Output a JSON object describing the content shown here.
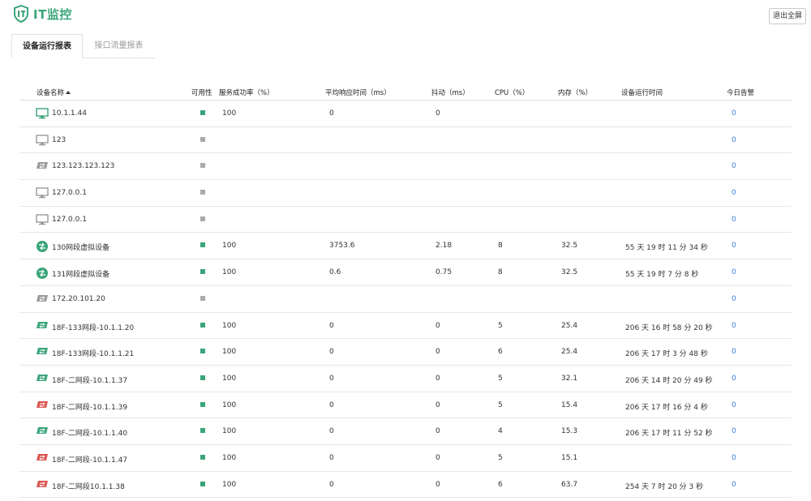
{
  "app": {
    "logo_text": "IT监控",
    "exit_fullscreen": "退出全屏"
  },
  "tabs": [
    {
      "label": "设备运行报表",
      "active": true
    },
    {
      "label": "接口流量报表",
      "active": false
    }
  ],
  "colors": {
    "brand": "#3aa57a",
    "available": "#3aa57a",
    "unavailable": "#aaaaaa",
    "device_green": "#3aa57a",
    "device_gray": "#999999",
    "device_red": "#d9534f",
    "link": "#3b7dd8"
  },
  "table": {
    "columns": [
      {
        "key": "name",
        "label": "设备名称",
        "sorted": "asc"
      },
      {
        "key": "availability",
        "label": "可用性"
      },
      {
        "key": "success_rate",
        "label": "服务成功率（%）"
      },
      {
        "key": "response_time",
        "label": "平均响应时间（ms）"
      },
      {
        "key": "jitter",
        "label": "抖动（ms）"
      },
      {
        "key": "cpu",
        "label": "CPU（%）"
      },
      {
        "key": "memory",
        "label": "内存（%）"
      },
      {
        "key": "uptime",
        "label": "设备运行时间"
      },
      {
        "key": "alerts",
        "label": "今日告警"
      }
    ],
    "rows": [
      {
        "icon": "monitor-icon",
        "icon_color": "green",
        "name": "10.1.1.44",
        "availability": "up",
        "success_rate": "100",
        "response_time": "0",
        "jitter": "0",
        "cpu": "",
        "memory": "",
        "uptime": "",
        "alerts": "0"
      },
      {
        "icon": "monitor-icon",
        "icon_color": "gray",
        "name": "123",
        "availability": "down",
        "success_rate": "",
        "response_time": "",
        "jitter": "",
        "cpu": "",
        "memory": "",
        "uptime": "",
        "alerts": "0"
      },
      {
        "icon": "switch-icon",
        "icon_color": "gray",
        "name": "123.123.123.123",
        "availability": "down",
        "success_rate": "",
        "response_time": "",
        "jitter": "",
        "cpu": "",
        "memory": "",
        "uptime": "",
        "alerts": "0"
      },
      {
        "icon": "monitor-icon",
        "icon_color": "gray",
        "name": "127.0.0.1",
        "availability": "down",
        "success_rate": "",
        "response_time": "",
        "jitter": "",
        "cpu": "",
        "memory": "",
        "uptime": "",
        "alerts": "0"
      },
      {
        "icon": "monitor-icon",
        "icon_color": "gray",
        "name": "127.0.0.1",
        "availability": "down",
        "success_rate": "",
        "response_time": "",
        "jitter": "",
        "cpu": "",
        "memory": "",
        "uptime": "",
        "alerts": "0"
      },
      {
        "icon": "router-icon",
        "icon_color": "green",
        "name": "130网段虚拟设备",
        "availability": "up",
        "success_rate": "100",
        "response_time": "3753.6",
        "jitter": "2.18",
        "cpu": "8",
        "memory": "32.5",
        "uptime": "55 天 19 时 11 分 34 秒",
        "alerts": "0"
      },
      {
        "icon": "router-icon",
        "icon_color": "green",
        "name": "131网段虚拟设备",
        "availability": "up",
        "success_rate": "100",
        "response_time": "0.6",
        "jitter": "0.75",
        "cpu": "8",
        "memory": "32.5",
        "uptime": "55 天 19 时 7 分 8 秒",
        "alerts": "0"
      },
      {
        "icon": "switch-icon",
        "icon_color": "gray",
        "name": "172.20.101.20",
        "availability": "down",
        "success_rate": "",
        "response_time": "",
        "jitter": "",
        "cpu": "",
        "memory": "",
        "uptime": "",
        "alerts": "0"
      },
      {
        "icon": "switch-icon",
        "icon_color": "green",
        "name": "18F-133网段-10.1.1.20",
        "availability": "up",
        "success_rate": "100",
        "response_time": "0",
        "jitter": "0",
        "cpu": "5",
        "memory": "25.4",
        "uptime": "206 天 16 时 58 分 20 秒",
        "alerts": "0"
      },
      {
        "icon": "switch-icon",
        "icon_color": "green",
        "name": "18F-133网段-10.1.1.21",
        "availability": "up",
        "success_rate": "100",
        "response_time": "0",
        "jitter": "0",
        "cpu": "6",
        "memory": "25.4",
        "uptime": "206 天 17 时 3 分 48 秒",
        "alerts": "0"
      },
      {
        "icon": "switch-icon",
        "icon_color": "green",
        "name": "18F-二网段-10.1.1.37",
        "availability": "up",
        "success_rate": "100",
        "response_time": "0",
        "jitter": "0",
        "cpu": "5",
        "memory": "32.1",
        "uptime": "206 天 14 时 20 分 49 秒",
        "alerts": "0"
      },
      {
        "icon": "switch-icon",
        "icon_color": "red",
        "name": "18F-二网段-10.1.1.39",
        "availability": "up",
        "success_rate": "100",
        "response_time": "0",
        "jitter": "0",
        "cpu": "5",
        "memory": "15.4",
        "uptime": "206 天 17 时 16 分 4 秒",
        "alerts": "0"
      },
      {
        "icon": "switch-icon",
        "icon_color": "green",
        "name": "18F-二网段-10.1.1.40",
        "availability": "up",
        "success_rate": "100",
        "response_time": "0",
        "jitter": "0",
        "cpu": "4",
        "memory": "15.3",
        "uptime": "206 天 17 时 11 分 52 秒",
        "alerts": "0"
      },
      {
        "icon": "switch-icon",
        "icon_color": "red",
        "name": "18F-二网段-10.1.1.47",
        "availability": "up",
        "success_rate": "100",
        "response_time": "0",
        "jitter": "0",
        "cpu": "5",
        "memory": "15.1",
        "uptime": "",
        "alerts": "0"
      },
      {
        "icon": "switch-icon",
        "icon_color": "red",
        "name": "18F-二网段10.1.1.38",
        "availability": "up",
        "success_rate": "100",
        "response_time": "0",
        "jitter": "0",
        "cpu": "6",
        "memory": "63.7",
        "uptime": "254 天 7 时 20 分 3 秒",
        "alerts": "0"
      }
    ]
  }
}
